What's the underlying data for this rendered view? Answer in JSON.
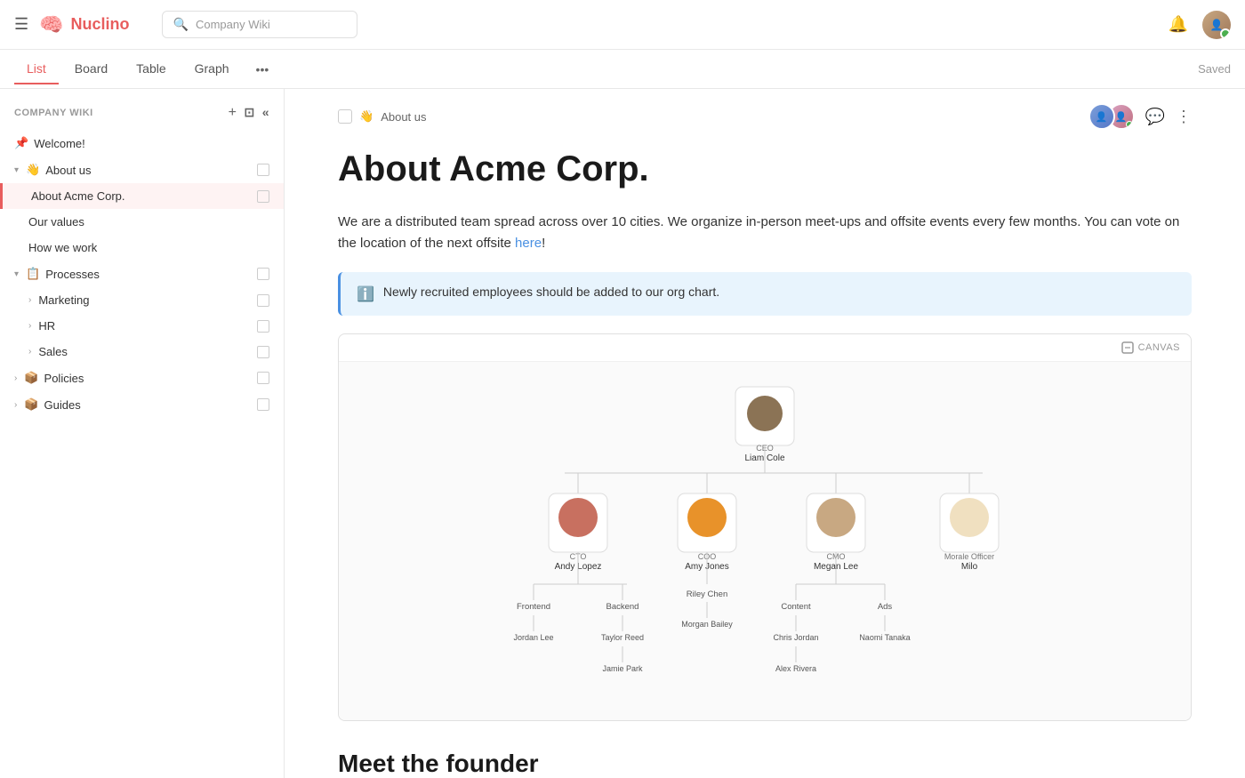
{
  "topbar": {
    "logo_text": "Nuclino",
    "search_placeholder": "Company Wiki",
    "saved_label": "Saved"
  },
  "tabs": [
    {
      "label": "List",
      "active": true
    },
    {
      "label": "Board",
      "active": false
    },
    {
      "label": "Table",
      "active": false
    },
    {
      "label": "Graph",
      "active": false
    }
  ],
  "sidebar": {
    "header": "COMPANY WIKI",
    "items": [
      {
        "label": "Welcome!",
        "emoji": "📌",
        "type": "welcome",
        "level": 0
      },
      {
        "label": "About us",
        "emoji": "👋",
        "type": "section",
        "expanded": true,
        "level": 0
      },
      {
        "label": "About Acme Corp.",
        "type": "page",
        "active": true,
        "level": 1
      },
      {
        "label": "Our values",
        "type": "page",
        "level": 1
      },
      {
        "label": "How we work",
        "type": "page",
        "level": 1
      },
      {
        "label": "Processes",
        "emoji": "📋",
        "type": "section",
        "expanded": true,
        "level": 0
      },
      {
        "label": "Marketing",
        "type": "folder",
        "level": 1
      },
      {
        "label": "HR",
        "type": "folder",
        "level": 1
      },
      {
        "label": "Sales",
        "type": "folder",
        "level": 1
      },
      {
        "label": "Policies",
        "emoji": "📦",
        "type": "section",
        "level": 0
      },
      {
        "label": "Guides",
        "emoji": "📦",
        "type": "section",
        "level": 0
      }
    ]
  },
  "content": {
    "breadcrumb": "About us",
    "breadcrumb_emoji": "👋",
    "page_title": "About Acme Corp.",
    "body_text_1": "We are a distributed team spread across over 10 cities. We organize in-person meet-ups and offsite events every few months. You can vote on the location of the next offsite ",
    "body_link": "here",
    "body_text_2": "!",
    "info_text": "Newly recruited employees should be added to our org chart.",
    "canvas_label": "CANVAS",
    "section_title": "Meet the founder"
  },
  "org_chart": {
    "ceo": {
      "role": "CEO",
      "name": "Liam Cole"
    },
    "level2": [
      {
        "role": "CTO",
        "name": "Andy Lopez"
      },
      {
        "role": "COO",
        "name": "Amy Jones"
      },
      {
        "role": "CMO",
        "name": "Megan Lee"
      },
      {
        "role": "Morale Officer",
        "name": "Milo"
      }
    ],
    "level3": [
      {
        "dept": "Frontend",
        "report": "Jordan Lee"
      },
      {
        "dept": "Backend",
        "report": "Taylor Reed",
        "subreport": "Jamie Park"
      },
      {
        "dept": "Riley Chen",
        "report": "Morgan Bailey"
      },
      {
        "dept": "Content",
        "report": "Chris Jordan",
        "subreport": "Alex Rivera"
      },
      {
        "dept": "Ads",
        "report": "Naomi Tanaka"
      }
    ]
  },
  "colors": {
    "accent": "#e85d5d",
    "link": "#4a90e2",
    "info_bg": "#e8f4fd"
  }
}
